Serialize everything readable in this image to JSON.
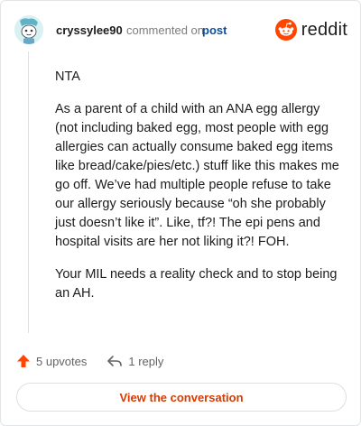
{
  "header": {
    "author": "cryssylee90",
    "action_text": "commented on",
    "post_link": "post",
    "brand": "reddit"
  },
  "comment": {
    "paragraphs": [
      "NTA",
      "As a parent of a child with an ANA egg allergy (not including baked egg, most people with egg allergies can actually consume baked egg items like bread/cake/pies/etc.) stuff like this makes me go off. We’ve had multiple people refuse to take our allergy seriously because “oh she probably just doesn’t like it”. Like, tf?! The epi pens and hospital visits are her not liking it?! FOH.",
      "Your MIL needs a reality check and to stop being an AH."
    ]
  },
  "footer": {
    "upvotes_label": "5 upvotes",
    "replies_label": "1 reply",
    "view_button": "View the conversation"
  },
  "colors": {
    "brand_orange": "#ff4500",
    "upvote": "#ff4500",
    "link_blue": "#0b4f9c",
    "button_text": "#d93a00"
  },
  "icons": {
    "avatar": "snoo-avatar",
    "brand": "reddit-logo-icon",
    "upvote": "upvote-arrow-icon",
    "reply": "reply-arrow-icon"
  }
}
